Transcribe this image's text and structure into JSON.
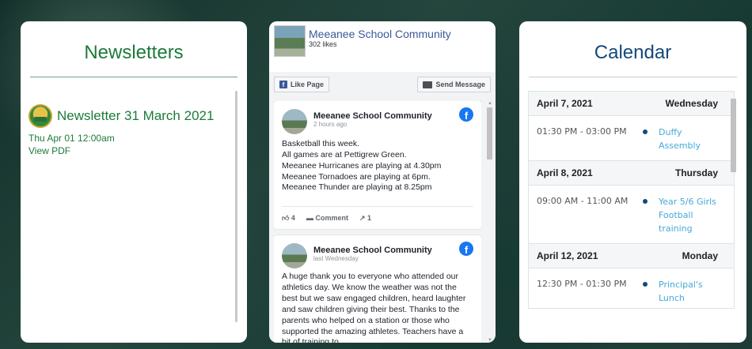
{
  "newsletters": {
    "title": "Newsletters",
    "items": [
      {
        "title": "Newsletter 31 March 2021",
        "date": "Thu Apr 01 12:00am",
        "link": "View PDF"
      }
    ]
  },
  "facebook": {
    "page_name": "Meeanee School Community",
    "likes": "302 likes",
    "like_button": "Like Page",
    "message_button": "Send Message",
    "posts": [
      {
        "author": "Meeanee School Community",
        "time": "2 hours ago",
        "lines": [
          "Basketball this week.",
          "All games are at Pettigrew Green.",
          "Meeanee Hurricanes are playing at 4.30pm",
          "Meeanee Tornadoes are playing at 6pm.",
          "Meeanee Thunder are playing at 8.25pm"
        ],
        "likes": "4",
        "comment_label": "Comment",
        "shares": "1"
      },
      {
        "author": "Meeanee School Community",
        "time": "last Wednesday",
        "text": "A huge thank you to everyone who attended our athletics day. We know the weather was not the best but we saw engaged children, heard laughter and saw children giving their best. Thanks to the parents who helped on a station or those who supported the amazing athletes. Teachers have a bit of training to"
      }
    ]
  },
  "calendar": {
    "title": "Calendar",
    "days": [
      {
        "date": "April 7, 2021",
        "weekday": "Wednesday",
        "events": [
          {
            "time": "01:30 PM - 03:00 PM",
            "name": "Duffy Assembly"
          }
        ]
      },
      {
        "date": "April 8, 2021",
        "weekday": "Thursday",
        "events": [
          {
            "time": "09:00 AM - 11:00 AM",
            "name": "Year 5/6 Girls Football training"
          }
        ]
      },
      {
        "date": "April 12, 2021",
        "weekday": "Monday",
        "events": [
          {
            "time": "12:30 PM - 01:30 PM",
            "name": "Principal's Lunch"
          }
        ]
      }
    ]
  },
  "icons": {
    "thumb": "thumbs-up-icon",
    "comment": "comment-icon",
    "share": "share-icon",
    "facebook": "facebook-logo-icon",
    "message": "messenger-icon"
  },
  "colors": {
    "newsletter_green": "#1d7a3a",
    "calendar_blue": "#12497a",
    "event_link": "#46a8d8",
    "facebook_blue": "#3b5998"
  }
}
